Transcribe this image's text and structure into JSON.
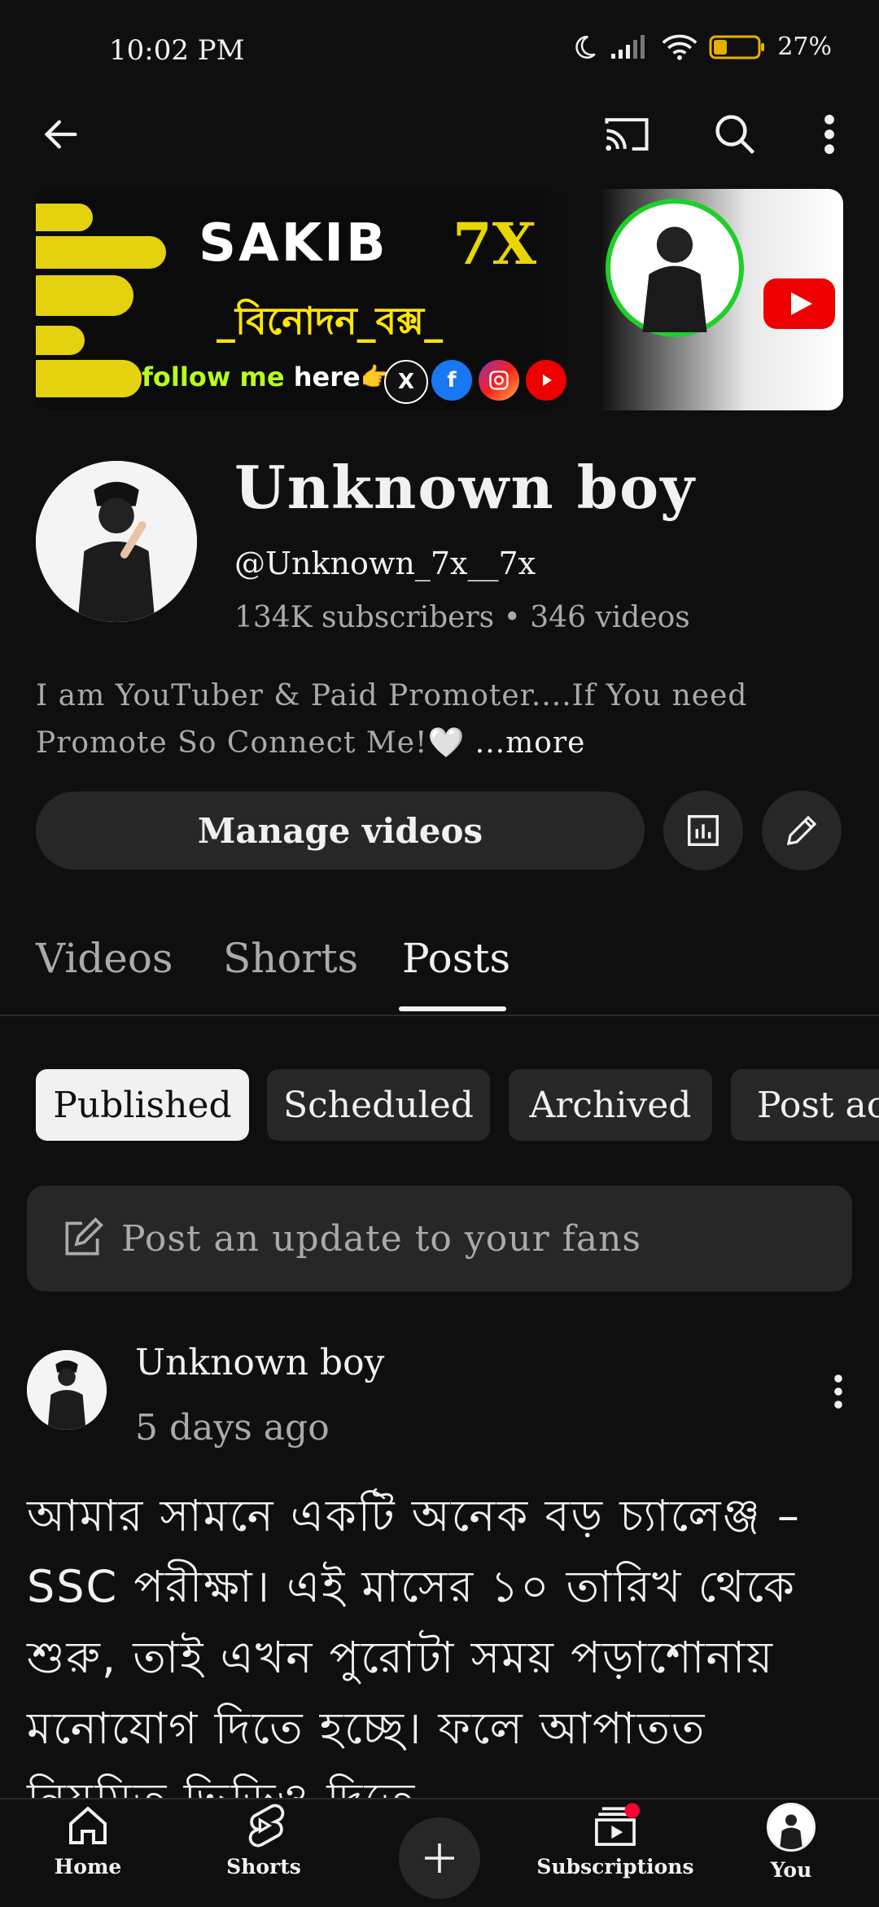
{
  "status_bar": {
    "time": "10:02 PM",
    "battery": "27%"
  },
  "banner": {
    "title": "SAKIB",
    "title_suffix": "7X",
    "bengali_line": "_বিনোদন_বক্স_",
    "follow_text": "follow me",
    "follow_text2": "here👉",
    "social_icons": [
      "x-icon",
      "facebook-icon",
      "instagram-icon",
      "youtube-icon"
    ]
  },
  "channel": {
    "name": "Unknown boy",
    "handle": "@Unknown_7x__7x",
    "stats": "134K subscribers • 346 videos",
    "description": "I am YouTuber & Paid Promoter....If You need Promote So Connect Me!🤍",
    "more_label": "...more"
  },
  "actions": {
    "manage_videos": "Manage videos"
  },
  "tabs": [
    {
      "label": "Videos",
      "active": false
    },
    {
      "label": "Shorts",
      "active": false
    },
    {
      "label": "Posts",
      "active": true
    }
  ],
  "filters": [
    {
      "label": "Published",
      "active": true
    },
    {
      "label": "Scheduled",
      "active": false
    },
    {
      "label": "Archived",
      "active": false
    },
    {
      "label": "Post activity",
      "active": false
    }
  ],
  "composer": {
    "placeholder": "Post an update to your fans"
  },
  "post": {
    "author": "Unknown boy",
    "time": "5 days ago",
    "body": "আমার সামনে একটি অনেক বড় চ্যালেঞ্জ – SSC পরীক্ষা। এই মাসের ১০ তারিখ থেকে শুরু, তাই এখন পুরোটা সময় পড়াশোনায় মনোযোগ দিতে হচ্ছে। ফলে আপাতত নিয়মিত ভিডিও দিতে"
  },
  "bottom_nav": [
    {
      "label": "Home",
      "icon": "home-icon"
    },
    {
      "label": "Shorts",
      "icon": "shorts-icon"
    },
    {
      "label": "",
      "icon": "plus-icon"
    },
    {
      "label": "Subscriptions",
      "icon": "subscriptions-icon"
    },
    {
      "label": "You",
      "icon": "avatar"
    }
  ],
  "colors": {
    "background": "#0f0f0f",
    "surface": "#272727",
    "text": "#f1f1f1",
    "muted": "#aaaaaa",
    "notification": "#ff0033"
  }
}
